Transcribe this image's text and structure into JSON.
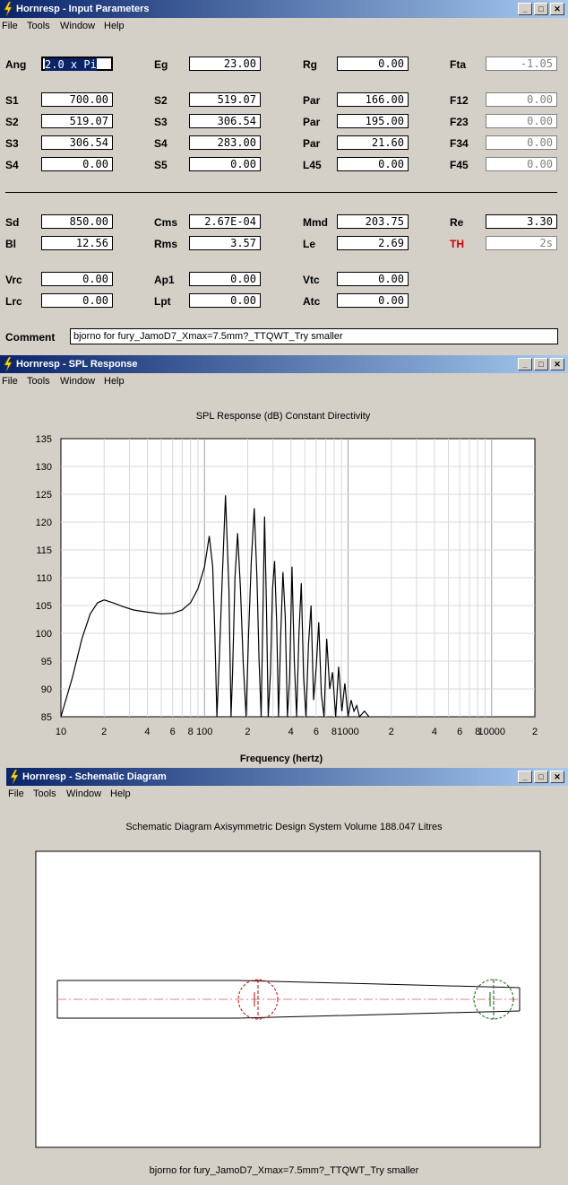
{
  "input_window": {
    "title": "Hornresp - Input Parameters",
    "menu": [
      "File",
      "Tools",
      "Window",
      "Help"
    ],
    "row1": [
      {
        "label": "Ang",
        "value": "2.0 x Pi",
        "selected": true
      },
      {
        "label": "Eg",
        "value": "23.00"
      },
      {
        "label": "Rg",
        "value": "0.00"
      },
      {
        "label": "Fta",
        "value": "-1.05",
        "disabled": true
      }
    ],
    "col1": [
      {
        "label": "S1",
        "value": "700.00"
      },
      {
        "label": "S2",
        "value": "519.07"
      },
      {
        "label": "S3",
        "value": "306.54"
      },
      {
        "label": "S4",
        "value": "0.00"
      }
    ],
    "col2": [
      {
        "label": "S2",
        "value": "519.07"
      },
      {
        "label": "S3",
        "value": "306.54"
      },
      {
        "label": "S4",
        "value": "283.00"
      },
      {
        "label": "S5",
        "value": "0.00"
      }
    ],
    "col3": [
      {
        "label": "Par",
        "value": "166.00"
      },
      {
        "label": "Par",
        "value": "195.00"
      },
      {
        "label": "Par",
        "value": "21.60"
      },
      {
        "label": "L45",
        "value": "0.00"
      }
    ],
    "col4": [
      {
        "label": "F12",
        "value": "0.00"
      },
      {
        "label": "F23",
        "value": "0.00"
      },
      {
        "label": "F34",
        "value": "0.00"
      },
      {
        "label": "F45",
        "value": "0.00"
      }
    ],
    "driver1": [
      {
        "label": "Sd",
        "value": "850.00"
      },
      {
        "label": "Cms",
        "value": "2.67E-04"
      },
      {
        "label": "Mmd",
        "value": "203.75"
      },
      {
        "label": "Re",
        "value": "3.30"
      }
    ],
    "driver2": [
      {
        "label": "Bl",
        "value": "12.56"
      },
      {
        "label": "Rms",
        "value": "3.57"
      },
      {
        "label": "Le",
        "value": "2.69"
      },
      {
        "label": "TH",
        "value": "2s",
        "label_color": "#cc0000",
        "disabled": true
      }
    ],
    "chamber1": [
      {
        "label": "Vrc",
        "value": "0.00"
      },
      {
        "label": "Ap1",
        "value": "0.00"
      },
      {
        "label": "Vtc",
        "value": "0.00"
      }
    ],
    "chamber2": [
      {
        "label": "Lrc",
        "value": "0.00"
      },
      {
        "label": "Lpt",
        "value": "0.00"
      },
      {
        "label": "Atc",
        "value": "0.00"
      }
    ],
    "comment_label": "Comment",
    "comment_value": "bjorno for fury_JamoD7_Xmax=7.5mm?_TTQWT_Try smaller"
  },
  "spl_window": {
    "title": "Hornresp - SPL Response",
    "menu": [
      "File",
      "Tools",
      "Window",
      "Help"
    ]
  },
  "chart_data": {
    "type": "line",
    "title": "SPL Response (dB)   Constant Directivity",
    "xlabel": "Frequency (hertz)",
    "ylabel": "",
    "x_scale": "log",
    "xlim": [
      10,
      20000
    ],
    "ylim": [
      85,
      135
    ],
    "y_ticks": [
      85,
      90,
      95,
      100,
      105,
      110,
      115,
      120,
      125,
      130,
      135
    ],
    "x_tick_labels": [
      {
        "f": 10,
        "t": "10"
      },
      {
        "f": 20,
        "t": "2"
      },
      {
        "f": 40,
        "t": "4"
      },
      {
        "f": 60,
        "t": "6"
      },
      {
        "f": 80,
        "t": "8"
      },
      {
        "f": 100,
        "t": "100"
      },
      {
        "f": 200,
        "t": "2"
      },
      {
        "f": 400,
        "t": "4"
      },
      {
        "f": 600,
        "t": "6"
      },
      {
        "f": 800,
        "t": "8"
      },
      {
        "f": 1000,
        "t": "1000"
      },
      {
        "f": 2000,
        "t": "2"
      },
      {
        "f": 4000,
        "t": "4"
      },
      {
        "f": 6000,
        "t": "6"
      },
      {
        "f": 8000,
        "t": "8"
      },
      {
        "f": 10000,
        "t": "10000"
      },
      {
        "f": 20000,
        "t": "2"
      }
    ],
    "grid": true,
    "series": [
      {
        "color": "#000000",
        "x": [
          10,
          12,
          14,
          16,
          18,
          20,
          23,
          27,
          32,
          40,
          50,
          60,
          70,
          80,
          90,
          100,
          108,
          114,
          118,
          122,
          127,
          133,
          140,
          148,
          153,
          157,
          163,
          170,
          178,
          186,
          195,
          203,
          212,
          222,
          232,
          240,
          248,
          255,
          262,
          270,
          278,
          288,
          298,
          308,
          318,
          328,
          340,
          352,
          365,
          378,
          392,
          407,
          422,
          438,
          455,
          472,
          490,
          510,
          530,
          552,
          575,
          600,
          625,
          652,
          680,
          710,
          745,
          780,
          820,
          860,
          905,
          950,
          1000,
          1050,
          1100,
          1150,
          1200,
          1300,
          1400
        ],
        "y": [
          85,
          92,
          99,
          103.5,
          105.5,
          106,
          105.5,
          104.8,
          104.2,
          103.8,
          103.5,
          103.6,
          104.2,
          105.5,
          108,
          112,
          117.5,
          112,
          100,
          85,
          96,
          110,
          124.8,
          108,
          85,
          93,
          110,
          118,
          108,
          95,
          85,
          100,
          113,
          122.5,
          110,
          95,
          85,
          103,
          121,
          105,
          85,
          93,
          108,
          113,
          102,
          85,
          100,
          111,
          103,
          85,
          92,
          112,
          95,
          85,
          100,
          109,
          92,
          85,
          98,
          105,
          88,
          94,
          102,
          89,
          85,
          99,
          90,
          93,
          85,
          94,
          86,
          91,
          85,
          88,
          86,
          87,
          85,
          86,
          85
        ]
      }
    ]
  },
  "schematic_window": {
    "title": "Hornresp - Schematic Diagram",
    "menu": [
      "File",
      "Tools",
      "Window",
      "Help"
    ],
    "heading": "Schematic Diagram   Axisymmetric Design   System Volume 188.047 Litres",
    "footer": "bjorno for fury_JamoD7_Xmax=7.5mm?_TTQWT_Try smaller",
    "driver_circle_color": "#cc0000",
    "port_circle_color": "#006600"
  }
}
